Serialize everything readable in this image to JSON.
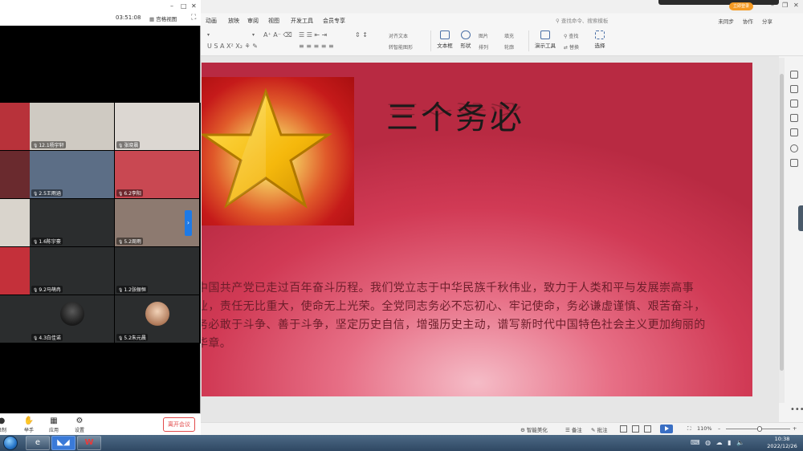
{
  "wps": {
    "menu": [
      "动画",
      "放映",
      "审阅",
      "视图",
      "开发工具",
      "会员专享"
    ],
    "command_search": "查找命令、搜索模板",
    "vip_label": "立即登录",
    "right_actions": [
      "未同步",
      "协作",
      "分享"
    ],
    "ribbon_small": [
      "对齐文本",
      "转智能图形"
    ],
    "ribbon_big": [
      "文本框",
      "形状",
      "图片",
      "填充",
      "排列",
      "轮廓",
      "演示工具",
      "查找",
      "替换",
      "选择"
    ],
    "slide": {
      "title": "三个务必",
      "body": "中国共产党已走过百年奋斗历程。我们党立志于中华民族千秋伟业，致力于人类和平与发展崇高事业，责任无比重大，使命无上光荣。全党同志务必不忘初心、牢记使命，务必谦虚谨慎、艰苦奋斗，务必敢于斗争、善于斗争，坚定历史自信，增强历史主动，谱写新时代中国特色社会主义更加绚丽的华章。"
    },
    "status": {
      "smart_beautify": "智能美化",
      "notes": "备注",
      "annotation": "批注",
      "zoom": "110%"
    }
  },
  "meeting": {
    "timer": "03:51:08",
    "view_mode": "宫格视图",
    "participants": [
      {
        "name": "",
        "bg": "#b8323a",
        "col": 0,
        "row": 0
      },
      {
        "name": "12.1杨宇轩",
        "bg": "#cfcac2",
        "col": 1,
        "row": 0
      },
      {
        "name": "张晓晨",
        "bg": "#dcd7d2",
        "col": 2,
        "row": 0
      },
      {
        "name": "",
        "bg": "#6a2a2e",
        "col": 0,
        "row": 1
      },
      {
        "name": "2.5王雨涵",
        "bg": "#5c6e86",
        "col": 1,
        "row": 1
      },
      {
        "name": "6.2李阳",
        "bg": "#c94852",
        "col": 2,
        "row": 1
      },
      {
        "name": "",
        "bg": "#d9d4cc",
        "col": 0,
        "row": 2
      },
      {
        "name": "1.6陈宇豪",
        "bg": "#2b2d2e",
        "col": 1,
        "row": 2
      },
      {
        "name": "5.2周雨",
        "bg": "#8d7a70",
        "col": 2,
        "row": 2
      },
      {
        "name": "",
        "bg": "#c4303a",
        "col": 0,
        "row": 3
      },
      {
        "name": "9.2马萌冉",
        "bg": "#2b2d2e",
        "col": 1,
        "row": 3
      },
      {
        "name": "1.2张俪恒",
        "bg": "#2b2d2e",
        "col": 2,
        "row": 3
      },
      {
        "name": "",
        "bg": "#2b2d2e",
        "col": 0,
        "row": 4
      },
      {
        "name": "4.3白佳诺",
        "bg": "#2b2d2e",
        "col": 1,
        "row": 4
      },
      {
        "name": "5.2朱元晨",
        "bg": "#2b2d2e",
        "col": 2,
        "row": 4
      }
    ],
    "toolbar": [
      {
        "label": "录制",
        "glyph": "●"
      },
      {
        "label": "举手",
        "glyph": "✋"
      },
      {
        "label": "应用",
        "glyph": "▦"
      },
      {
        "label": "设置",
        "glyph": "⚙"
      }
    ],
    "leave_label": "离开会议"
  },
  "taskbar": {
    "time": "10:38",
    "date": "2022/12/26"
  },
  "colors": {
    "accent_blue": "#1e7ae6",
    "leave_red": "#e24a4a",
    "slide_red": "#d13a55"
  }
}
